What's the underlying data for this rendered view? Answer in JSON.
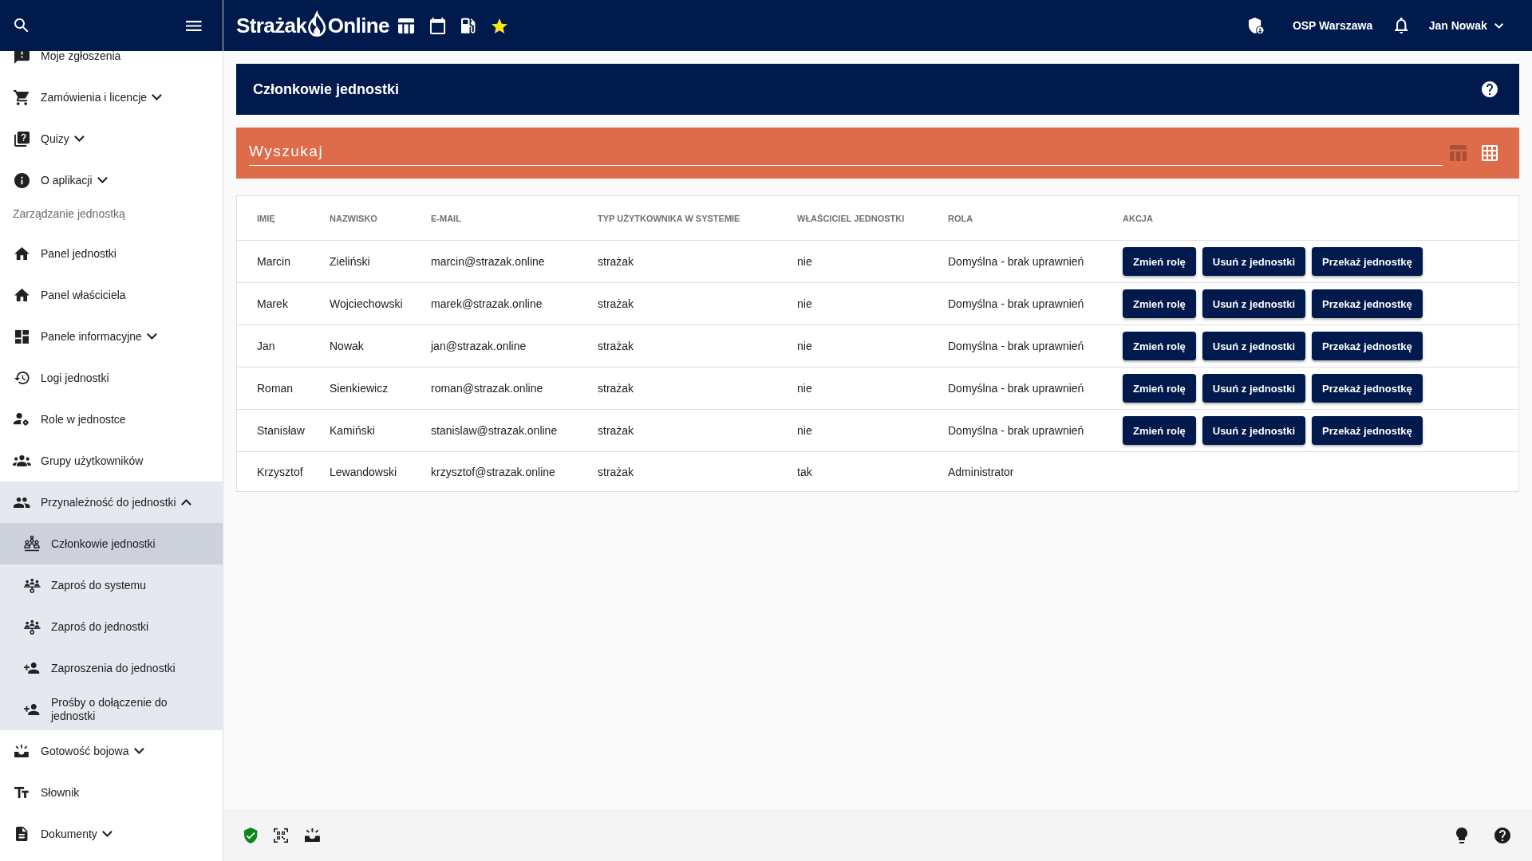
{
  "top_bar": {
    "logo": [
      "Strażak",
      "Online"
    ],
    "organization": "OSP Warszawa",
    "user": "Jan Nowak"
  },
  "sidebar": {
    "items": [
      {
        "kind": "link",
        "label": "Moje zgłoszenia",
        "selected": false
      },
      {
        "kind": "group",
        "label": "Zamówienia i licencje",
        "expanded": false,
        "selected": false
      },
      {
        "kind": "group",
        "label": "Quizy",
        "expanded": false,
        "selected": false
      },
      {
        "kind": "group",
        "label": "O aplikacji",
        "expanded": false,
        "selected": false
      },
      {
        "kind": "section",
        "label": "Zarządzanie jednostką"
      },
      {
        "kind": "link",
        "label": "Panel jednostki",
        "selected": false
      },
      {
        "kind": "link",
        "label": "Panel właściciela",
        "selected": false
      },
      {
        "kind": "group",
        "label": "Panele informacyjne",
        "expanded": false,
        "selected": false
      },
      {
        "kind": "link",
        "label": "Logi jednostki",
        "selected": false
      },
      {
        "kind": "link",
        "label": "Role w jednostce",
        "selected": false
      },
      {
        "kind": "link",
        "label": "Grupy użytkowników",
        "selected": false
      },
      {
        "kind": "group",
        "label": "Przynależność do jednostki",
        "expanded": true,
        "selected": false,
        "children": [
          {
            "label": "Członkowie jednostki",
            "selected": true
          },
          {
            "label": "Zaproś do systemu",
            "selected": false
          },
          {
            "label": "Zaproś do jednostki",
            "selected": false
          },
          {
            "label": "Zaproszenia do jednostki",
            "selected": false
          },
          {
            "label": "Prośby o dołączenie do jednostki",
            "selected": false
          }
        ]
      },
      {
        "kind": "group",
        "label": "Gotowość bojowa",
        "expanded": false,
        "selected": false
      },
      {
        "kind": "link",
        "label": "Słownik",
        "selected": false
      },
      {
        "kind": "group",
        "label": "Dokumenty",
        "expanded": false,
        "selected": false
      }
    ]
  },
  "page_header": {
    "title": "Członkowie jednostki"
  },
  "search": {
    "placeholder": "Wyszukaj",
    "views": [
      {
        "kind": "table",
        "selected": false
      },
      {
        "kind": "grid",
        "selected": true
      }
    ]
  },
  "table": {
    "columns": [
      "IMIĘ",
      "NAZWISKO",
      "E-MAIL",
      "TYP UŻYTKOWNIKA W SYSTEMIE",
      "WŁAŚCICIEL JEDNOSTKI",
      "ROLA",
      "AKCJA"
    ],
    "rows": [
      {
        "cells": [
          "Marcin",
          "Zieliński",
          "marcin@strazak.online",
          "strażak",
          "nie",
          "Domyślna - brak uprawnień"
        ],
        "actions": [
          "Zmień rolę",
          "Usuń z jednostki",
          "Przekaż jednostkę"
        ]
      },
      {
        "cells": [
          "Marek",
          "Wojciechowski",
          "marek@strazak.online",
          "strażak",
          "nie",
          "Domyślna - brak uprawnień"
        ],
        "actions": [
          "Zmień rolę",
          "Usuń z jednostki",
          "Przekaż jednostkę"
        ]
      },
      {
        "cells": [
          "Jan",
          "Nowak",
          "jan@strazak.online",
          "strażak",
          "nie",
          "Domyślna - brak uprawnień"
        ],
        "actions": [
          "Zmień rolę",
          "Usuń z jednostki",
          "Przekaż jednostkę"
        ]
      },
      {
        "cells": [
          "Roman",
          "Sienkiewicz",
          "roman@strazak.online",
          "strażak",
          "nie",
          "Domyślna - brak uprawnień"
        ],
        "actions": [
          "Zmień rolę",
          "Usuń z jednostki",
          "Przekaż jednostkę"
        ]
      },
      {
        "cells": [
          "Stanisław",
          "Kamiński",
          "stanislaw@strazak.online",
          "strażak",
          "nie",
          "Domyślna - brak uprawnień"
        ],
        "actions": [
          "Zmień rolę",
          "Usuń z jednostki",
          "Przekaż jednostkę"
        ]
      },
      {
        "cells": [
          "Krzysztof",
          "Lewandowski",
          "krzysztof@strazak.online",
          "strażak",
          "tak",
          "Administrator"
        ]
      }
    ]
  }
}
